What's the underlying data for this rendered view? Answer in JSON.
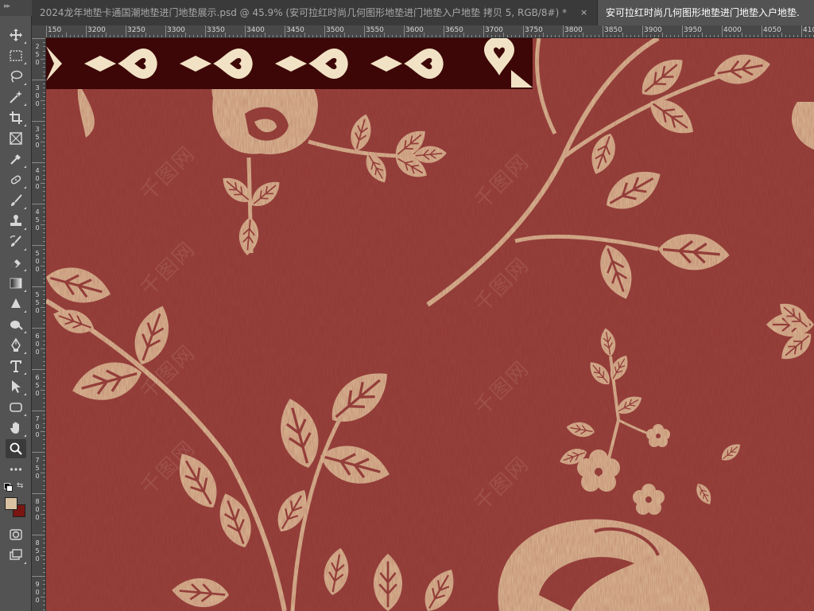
{
  "tabs": [
    {
      "label": "2024龙年地垫卡通国潮地垫进门地垫展示.psd @ 45.9% (安可拉红时尚几何图形地垫进门地垫入户地垫 拷贝 5, RGB/8#) *",
      "close": "×",
      "active": false
    },
    {
      "label": "安可拉红时尚几何图形地垫进门地垫入户地垫.",
      "active": true
    }
  ],
  "toolbar": {
    "grip": "▸▸",
    "tools": [
      "move-tool-icon",
      "rectangular-marquee-icon",
      "lasso-icon",
      "magic-wand-icon",
      "crop-icon",
      "frame-icon",
      "eyedropper-icon",
      "healing-brush-icon",
      "brush-icon",
      "clone-stamp-icon",
      "history-brush-icon",
      "eraser-icon",
      "gradient-icon",
      "blur-icon",
      "dodge-icon",
      "pen-icon",
      "type-icon",
      "path-selection-icon",
      "rectangle-shape-icon",
      "hand-icon",
      "zoom-icon",
      "more-tools-icon"
    ],
    "active_tool": "zoom-icon",
    "foreground_color": "#d9c3a2",
    "background_color": "#7a1612"
  },
  "ruler": {
    "h_labels": [
      "150",
      "3200",
      "3250",
      "3300",
      "3350",
      "3400",
      "3450",
      "3500",
      "3550",
      "3600",
      "3650",
      "3700",
      "3750",
      "3800",
      "3850",
      "3900",
      "3950",
      "4000",
      "4050",
      "4100"
    ],
    "v_labels": [
      "2\n5\n0",
      "3\n0\n0",
      "3\n5\n0",
      "4\n0\n0",
      "4\n5\n0",
      "5\n0\n0",
      "5\n5\n0",
      "6\n0\n0",
      "6\n5\n0",
      "7\n0\n0",
      "7\n5\n0",
      "8\n0\n0",
      "8\n5\n0",
      "9\n0\n0"
    ]
  },
  "canvas": {
    "background": "#913a36",
    "motif": "#d7b38f",
    "band": "#3d0707",
    "band_motif": "#f2e2c5",
    "watermark": "千图网"
  }
}
